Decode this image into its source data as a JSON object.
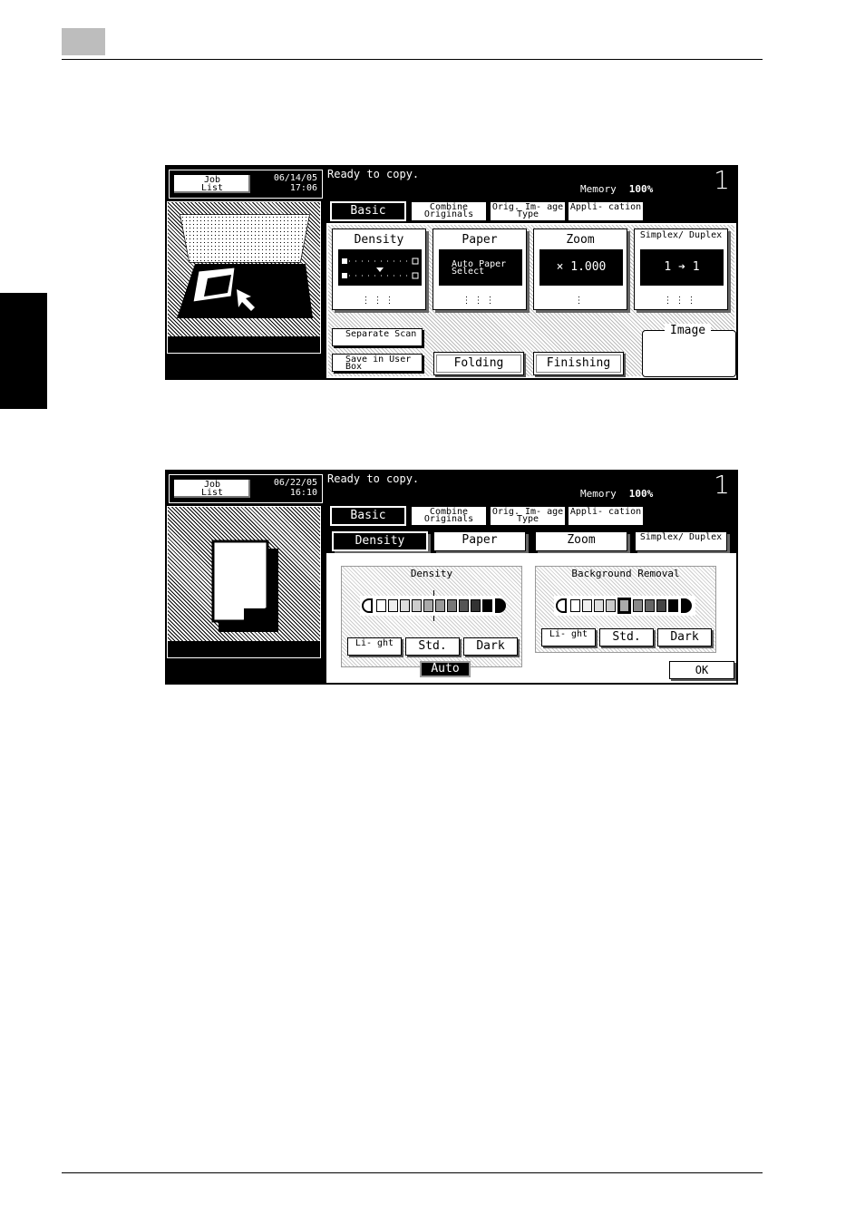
{
  "screen1": {
    "job_list": "Job List",
    "date": "06/14/05",
    "time": "17:06",
    "status": "Ready to copy.",
    "memory_label": "Memory",
    "memory_value": "100%",
    "copies": "1",
    "tabs": [
      "Basic",
      "Combine Originals",
      "Orig. Im- age Type",
      "Appli- cation"
    ],
    "functions": [
      {
        "label": "Density",
        "value": ""
      },
      {
        "label": "Paper",
        "value": "Auto Paper Select"
      },
      {
        "label": "Zoom",
        "value": "× 1.000"
      },
      {
        "label": "Simplex/ Duplex",
        "value": "1 ➔ 1"
      }
    ],
    "separate_scan": "Separate Scan",
    "save_user_box": "Save in User Box",
    "folding": "Folding",
    "finishing": "Finishing",
    "image": "Image"
  },
  "screen2": {
    "job_list": "Job List",
    "date": "06/22/05",
    "time": "16:10",
    "status": "Ready to copy.",
    "memory_label": "Memory",
    "memory_value": "100%",
    "copies": "1",
    "tabs": [
      "Basic",
      "Combine Originals",
      "Orig. Im- age Type",
      "Appli- cation"
    ],
    "subtabs": [
      "Density",
      "Paper",
      "Zoom",
      "Simplex/ Duplex"
    ],
    "density_title": "Density",
    "bg_title": "Background Removal",
    "light": "Li- ght",
    "std": "Std.",
    "dark": "Dark",
    "auto": "Auto",
    "ok": "OK"
  }
}
